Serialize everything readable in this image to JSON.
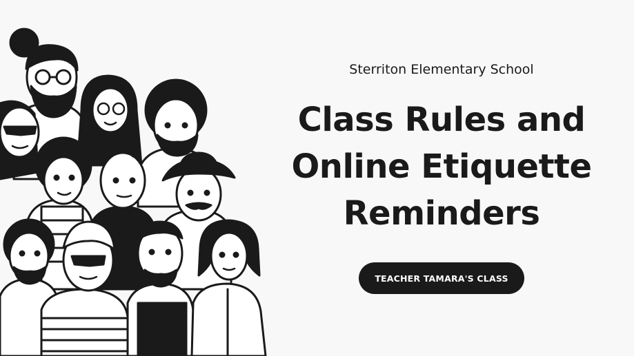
{
  "school_name": "Sterriton Elementary School",
  "title_lines": [
    "Class Rules and",
    "Online Etiquette",
    "Reminders"
  ],
  "class_badge": "TEACHER TAMARA'S CLASS",
  "colors": {
    "background": "#f8f8f8",
    "ink": "#1a1a1a",
    "badge_text": "#ffffff"
  },
  "illustration": {
    "icon": "diverse-people-crowd-illustration"
  }
}
